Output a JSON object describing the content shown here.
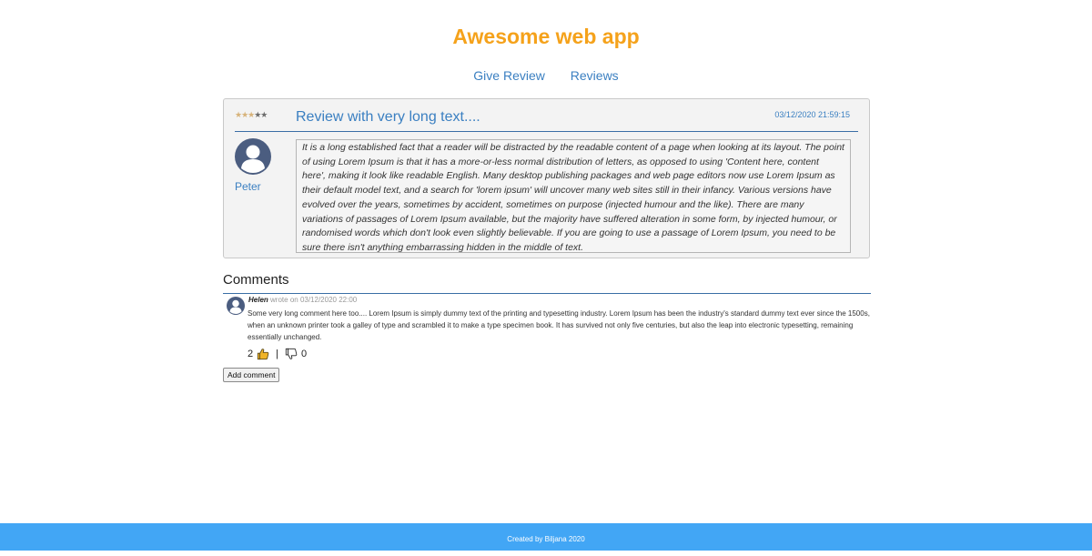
{
  "app": {
    "title": "Awesome web app"
  },
  "nav": {
    "give_review": "Give Review",
    "reviews": "Reviews"
  },
  "review": {
    "rating": 3,
    "max_rating": 5,
    "stars_filled": "★★★",
    "stars_empty": "★★",
    "title": "Review with very long text....",
    "date": "03/12/2020 21:59:15",
    "author": "Peter",
    "body": "It is a long established fact that a reader will be distracted by the readable content of a page when looking at its layout. The point of using Lorem Ipsum is that it has a more-or-less normal distribution of letters, as opposed to using 'Content here, content here', making it look like readable English. Many desktop publishing packages and web page editors now use Lorem Ipsum as their default model text, and a search for 'lorem ipsum' will uncover many web sites still in their infancy. Various versions have evolved over the years, sometimes by accident, sometimes on purpose (injected humour and the like). There are many variations of passages of Lorem Ipsum available, but the majority have suffered alteration in some form, by injected humour, or randomised words which don't look even slightly believable. If you are going to use a passage of Lorem Ipsum, you need to be sure there isn't anything embarrassing hidden in the middle of text."
  },
  "comments": {
    "heading": "Comments",
    "items": [
      {
        "author": "Helen",
        "meta": "wrote on 03/12/2020 22:00",
        "text": "Some very long comment here too.... Lorem Ipsum is simply dummy text of the printing and typesetting industry. Lorem Ipsum has been the industry's standard dummy text ever since the 1500s, when an unknown printer took a galley of type and scrambled it to make a type specimen book. It has survived not only five centuries, but also the leap into electronic typesetting, remaining essentially unchanged.",
        "likes": "2",
        "separator": "|",
        "dislikes": "0"
      }
    ],
    "add_label": "Add comment"
  },
  "footer": {
    "text": "Created by Biljana 2020"
  },
  "colors": {
    "title": "#f5a21b",
    "link": "#3a7fc1",
    "footer": "#42a6f5",
    "avatar": "#4b5d80",
    "thumb_up": "#f0b429"
  },
  "icons": {
    "avatar": "user-avatar-icon",
    "like": "thumbs-up-icon",
    "dislike": "thumbs-down-icon"
  }
}
